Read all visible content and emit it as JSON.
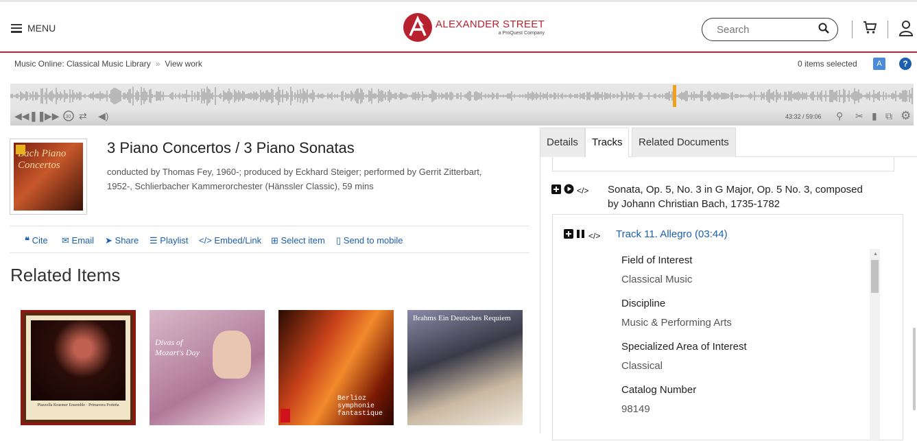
{
  "header": {
    "menu_label": "MENU",
    "logo_text": "ALEXANDER STREET",
    "logo_sub": "a ProQuest Company",
    "search_placeholder": "Search"
  },
  "breadcrumb": {
    "items": [
      "Music Online: Classical Music Library",
      "View work"
    ],
    "separator": "»"
  },
  "selection": {
    "count_text": "0 items selected"
  },
  "player": {
    "time": "43:32 / 59:06",
    "progress": 0.736,
    "colors": {
      "wave": "#8a8a8a",
      "cursor": "#f0a020"
    }
  },
  "record": {
    "title": "3 Piano Concertos / 3 Piano Sonatas",
    "credits_line1": "conducted by Thomas Fey, 1960-; produced by Eckhard Steiger; performed by Gerrit Zitterbart,",
    "credits_line2": "1952-, Schlierbacher Kammerorchester (Hänssler Classic), 59 mins",
    "cover_label": "Bach Piano Concertos"
  },
  "actions": [
    {
      "label": "Cite",
      "icon": "quote-icon"
    },
    {
      "label": "Email",
      "icon": "envelope-icon"
    },
    {
      "label": "Share",
      "icon": "share-icon"
    },
    {
      "label": "Playlist",
      "icon": "list-icon"
    },
    {
      "label": "Embed/Link",
      "icon": "code-icon"
    },
    {
      "label": "Select item",
      "icon": "plus-square-icon"
    },
    {
      "label": "Send to mobile",
      "icon": "mobile-icon"
    }
  ],
  "related": {
    "heading": "Related Items",
    "items": [
      {
        "caption": "Piazzolla Kraemer Ensemble · Primavera Porteña"
      },
      {
        "caption": "Divas of Mozart's Day"
      },
      {
        "caption": "Berlioz symphonie fantastique"
      },
      {
        "caption": "Brahms Ein Deutsches Requiem"
      }
    ]
  },
  "tabs": [
    "Details",
    "Tracks",
    "Related Documents"
  ],
  "tracks": {
    "work_title_line1": "Sonata, Op. 5, No. 3 in G Major, Op. 5 No. 3, composed",
    "work_title_line2": "by Johann Christian Bach, 1735-1782",
    "track_title": "Track 11. Allegro (03:44)",
    "fields": [
      {
        "label": "Field of Interest",
        "value": "Classical Music"
      },
      {
        "label": "Discipline",
        "value": "Music & Performing Arts"
      },
      {
        "label": "Specialized Area of Interest",
        "value": "Classical"
      },
      {
        "label": "Catalog Number",
        "value": "98149"
      }
    ]
  },
  "colors": {
    "accent_red": "#c8202f",
    "link_blue": "#1b5fae"
  }
}
